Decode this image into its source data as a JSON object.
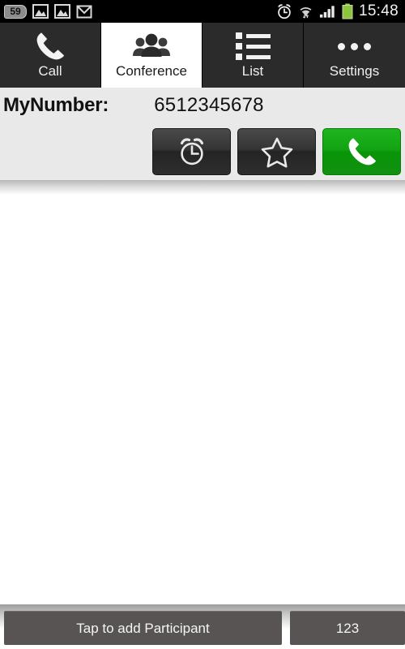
{
  "statusbar": {
    "notification_badge": "59",
    "left_icons": [
      "notification-count-badge",
      "gallery-image-icon",
      "gallery-image-icon",
      "gmail-icon"
    ],
    "right_icons": [
      "alarm-clock-icon",
      "wifi-icon",
      "signal-bars-icon",
      "battery-icon"
    ],
    "time": "15:48",
    "background_color": "#000000",
    "battery_color": "#8cc63f"
  },
  "tabs": [
    {
      "label": "Call",
      "icon": "phone-handset-icon",
      "selected": false
    },
    {
      "label": "Conference",
      "icon": "group-people-icon",
      "selected": true
    },
    {
      "label": "List",
      "icon": "bulleted-list-icon",
      "selected": false
    },
    {
      "label": "Settings",
      "icon": "three-dots-icon",
      "selected": false
    }
  ],
  "number_panel": {
    "label": "MyNumber:",
    "value": "6512345678",
    "background_color": "#e9e9e9"
  },
  "action_buttons": [
    {
      "name": "alarm-button",
      "icon": "alarm-clock-icon",
      "style": "dark"
    },
    {
      "name": "favorite-button",
      "icon": "star-outline-icon",
      "style": "dark"
    },
    {
      "name": "call-button",
      "icon": "phone-handset-icon",
      "style": "green",
      "color": "#12a312"
    }
  ],
  "content": {
    "participants": [],
    "empty": true
  },
  "bottom_bar": {
    "add_participant_label": "Tap to add Participant",
    "keypad_label": "123",
    "button_color": "#575453"
  }
}
